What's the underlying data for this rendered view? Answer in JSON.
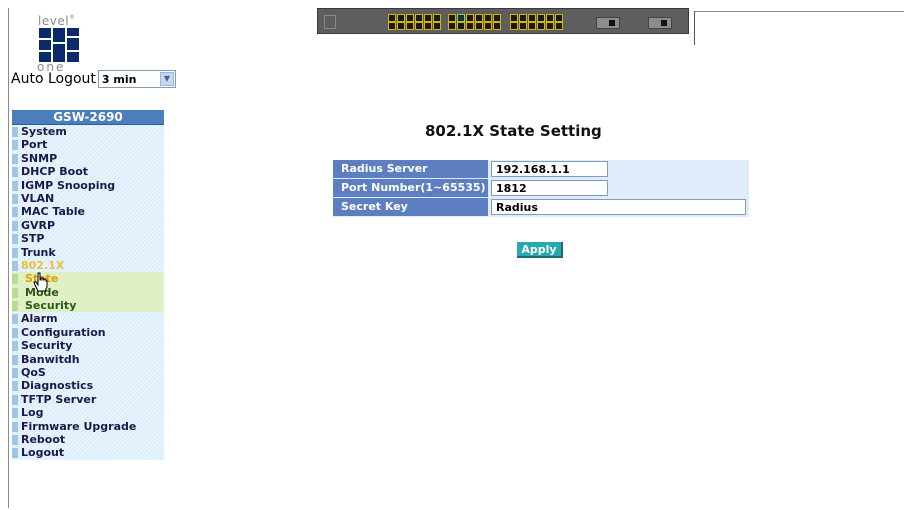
{
  "logo": {
    "top": "level",
    "bottom": "one"
  },
  "auto_logout": {
    "label": "Auto Logout",
    "value": "3 min"
  },
  "menu": {
    "header": "GSW-2690",
    "items": [
      {
        "label": "System",
        "state": "normal"
      },
      {
        "label": "Port",
        "state": "normal"
      },
      {
        "label": "SNMP",
        "state": "normal"
      },
      {
        "label": "DHCP Boot",
        "state": "normal"
      },
      {
        "label": "IGMP Snooping",
        "state": "normal"
      },
      {
        "label": "VLAN",
        "state": "normal"
      },
      {
        "label": "MAC Table",
        "state": "normal"
      },
      {
        "label": "GVRP",
        "state": "normal"
      },
      {
        "label": "STP",
        "state": "normal"
      },
      {
        "label": "Trunk",
        "state": "normal"
      },
      {
        "label": "802.1X",
        "state": "active"
      },
      {
        "label": "State",
        "state": "sub-current"
      },
      {
        "label": "Mode",
        "state": "sub"
      },
      {
        "label": "Security",
        "state": "sub"
      },
      {
        "label": "Alarm",
        "state": "normal"
      },
      {
        "label": "Configuration",
        "state": "normal"
      },
      {
        "label": "Security",
        "state": "normal"
      },
      {
        "label": "Banwitdh",
        "state": "normal"
      },
      {
        "label": "QoS",
        "state": "normal"
      },
      {
        "label": "Diagnostics",
        "state": "normal"
      },
      {
        "label": "TFTP Server",
        "state": "normal"
      },
      {
        "label": "Log",
        "state": "normal"
      },
      {
        "label": "Firmware Upgrade",
        "state": "normal"
      },
      {
        "label": "Reboot",
        "state": "normal"
      },
      {
        "label": "Logout",
        "state": "normal"
      }
    ]
  },
  "main": {
    "title": "802.1X State Setting",
    "fields": [
      {
        "label": "Radius Server",
        "value": "192.168.1.1"
      },
      {
        "label": "Port Number(1~65535)",
        "value": "1812"
      },
      {
        "label": "Secret Key",
        "value": "Radius"
      }
    ],
    "apply_label": "Apply"
  },
  "colors": {
    "menu_header": "#4a7ebd",
    "field_label_bg": "#5d7fc2",
    "apply_button": "#27a9ad",
    "active_menu_text": "#e8c23a"
  }
}
